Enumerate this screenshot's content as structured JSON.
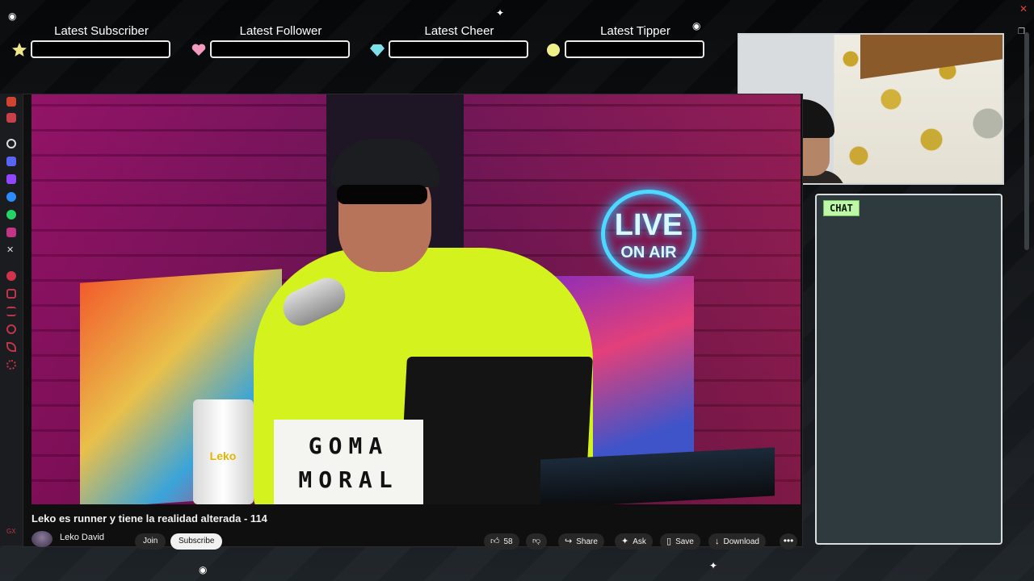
{
  "alerts": [
    {
      "label": "Latest Subscriber",
      "icon": "star-icon",
      "color": "#f0e68c"
    },
    {
      "label": "Latest Follower",
      "icon": "heart-icon",
      "color": "#f49ac1"
    },
    {
      "label": "Latest Cheer",
      "icon": "gem-icon",
      "color": "#7ce0e8"
    },
    {
      "label": "Latest Tipper",
      "icon": "coin-icon",
      "color": "#eef08a"
    }
  ],
  "chat": {
    "label": "CHAT",
    "accent": "#bff7a9"
  },
  "video": {
    "title": "Leko es runner y tiene la realidad alterada - 114",
    "sign_line1": "GOMA",
    "sign_line2": "MORAL",
    "neon_line1": "LIVE",
    "neon_line2": "ON AIR",
    "cup_logo": "Leko"
  },
  "channel": {
    "name": "Leko David",
    "join_label": "Join",
    "subscribe_label": "Subscribe"
  },
  "actions": {
    "likes": "58",
    "share_label": "Share",
    "ask_label": "Ask",
    "save_label": "Save",
    "download_label": "Download",
    "more_label": "•••"
  },
  "strip_icons": [
    "streamelements-icon",
    "medium-icon",
    "threads-icon",
    "discord-icon",
    "twitch-icon",
    "messenger-icon",
    "whatsapp-icon",
    "instagram-icon",
    "x-icon",
    "spotify-icon",
    "pin-icon",
    "list-icon",
    "clock-icon",
    "leaf-icon",
    "settings-icon"
  ],
  "strip_label": "GX"
}
